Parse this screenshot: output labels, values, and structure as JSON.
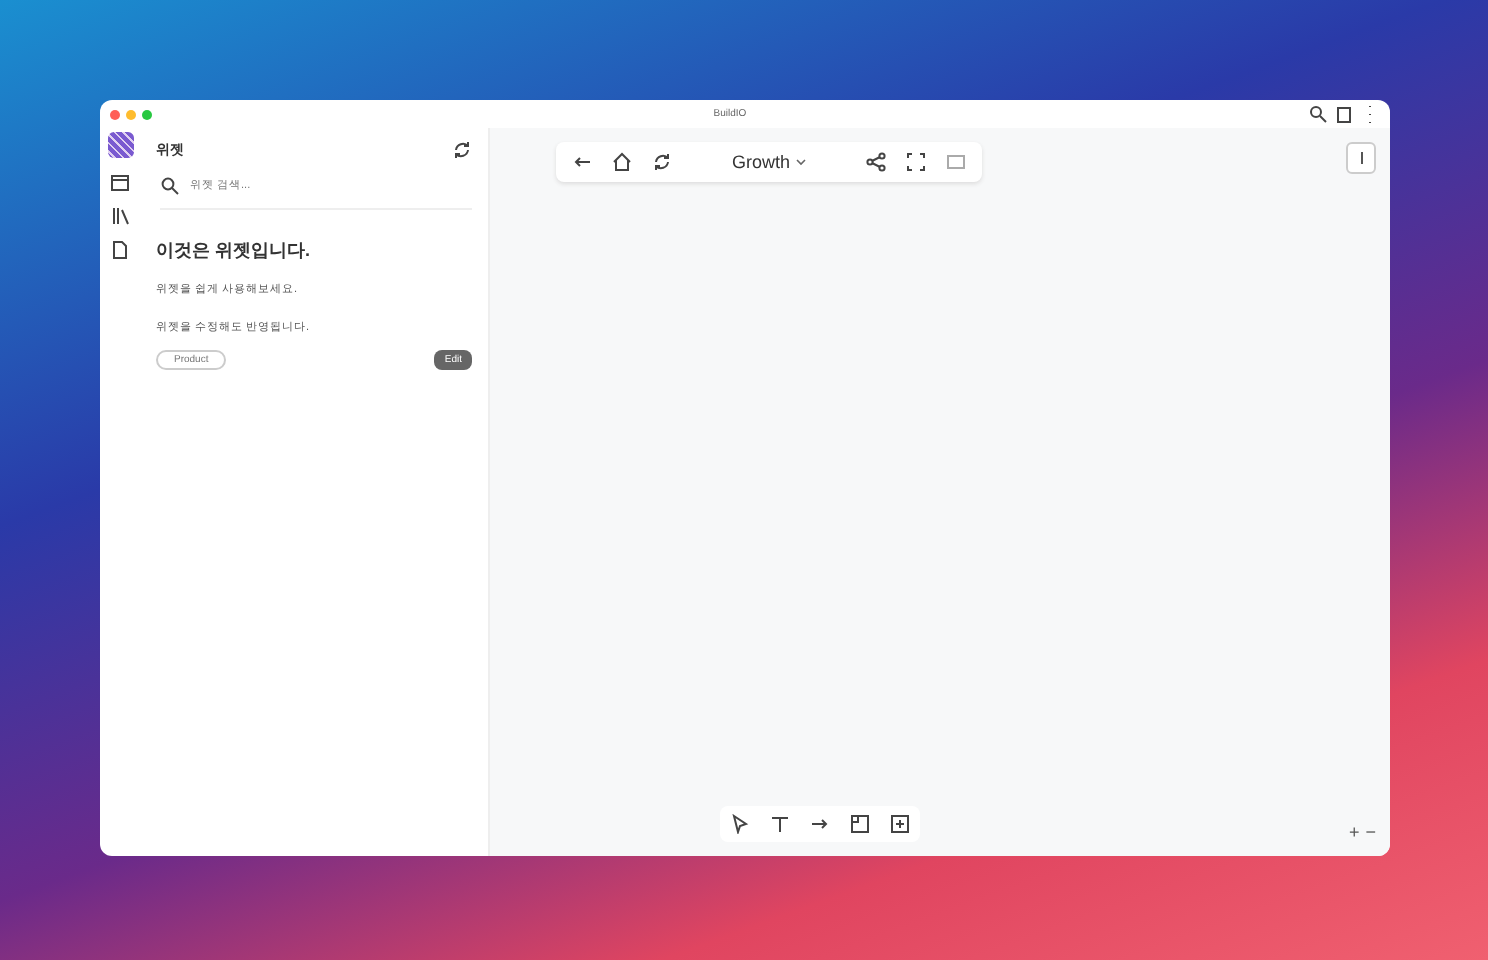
{
  "window": {
    "title": "BuildIO"
  },
  "rail": [
    {
      "kind": "archive"
    },
    {
      "kind": "library"
    },
    {
      "kind": "file"
    }
  ],
  "sidebar": {
    "title": "위젯",
    "search": {
      "placeholder": "위젯 검색..."
    },
    "card": {
      "title": "이것은 위젯입니다.",
      "lines": [
        "위젯을 쉽게 사용해보세요.",
        "위젯을 수정해도 반영됩니다."
      ],
      "tag": "Product",
      "button": "Edit"
    }
  },
  "toolbar": {
    "board": "Growth"
  },
  "tools": [
    {
      "kind": "pointer"
    },
    {
      "kind": "text"
    },
    {
      "kind": "arrow"
    },
    {
      "kind": "frame"
    },
    {
      "kind": "add"
    }
  ],
  "zoom": {
    "in": "+",
    "out": "−"
  }
}
